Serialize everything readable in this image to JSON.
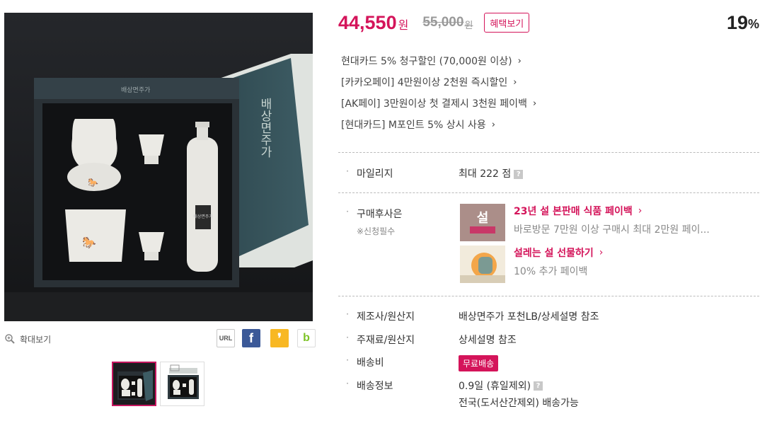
{
  "price": {
    "sale": "44,550",
    "sale_unit": "원",
    "original": "55,000",
    "original_unit": "원",
    "benefit_button": "혜택보기",
    "discount": "19",
    "discount_unit": "%"
  },
  "promotions": [
    "현대카드 5% 청구할인 (70,000원 이상)",
    "[카카오페이] 4만원이상 2천원 즉시할인",
    "[AK페이] 3만원이상 첫 결제시 3천원 페이백",
    "[현대카드] M포인트 5% 상시 사용"
  ],
  "mileage": {
    "label": "마일리지",
    "value": "최대 222 점"
  },
  "after_purchase": {
    "label": "구매후사은",
    "sublabel": "※신청필수",
    "items": [
      {
        "title": "23년 설 본판매 식품 페이백",
        "desc": "바로방문 7만원 이상 구매시 최대 2만원 페이..."
      },
      {
        "title": "설레는 설 선물하기",
        "desc": "10% 추가 페이백"
      }
    ]
  },
  "details": {
    "maker_label": "제조사/원산지",
    "maker_value": "배상면주가 포천LB/상세설명 참조",
    "material_label": "주재료/원산지",
    "material_value": "상세설명 참조",
    "shipping_fee_label": "배송비",
    "shipping_fee_badge": "무료배송",
    "shipping_info_label": "배송정보",
    "shipping_info_line1": "0.9일 (휴일제외)",
    "shipping_info_line2": "전국(도서산간제외) 배송가능"
  },
  "image_area": {
    "zoom_label": "확대보기",
    "box_lid_text": "배상면주가",
    "box_label_text": "배상면주가"
  },
  "share": {
    "url": "URL",
    "facebook": "f",
    "kakaostory": "❜",
    "band": "b"
  },
  "help_icon": "?",
  "bullet": "·",
  "arrow": "›",
  "colors": {
    "accent": "#d4145a",
    "strike": "#999999",
    "facebook": "#3b5998",
    "kakaostory": "#f8b823",
    "band": "#7cc325"
  }
}
